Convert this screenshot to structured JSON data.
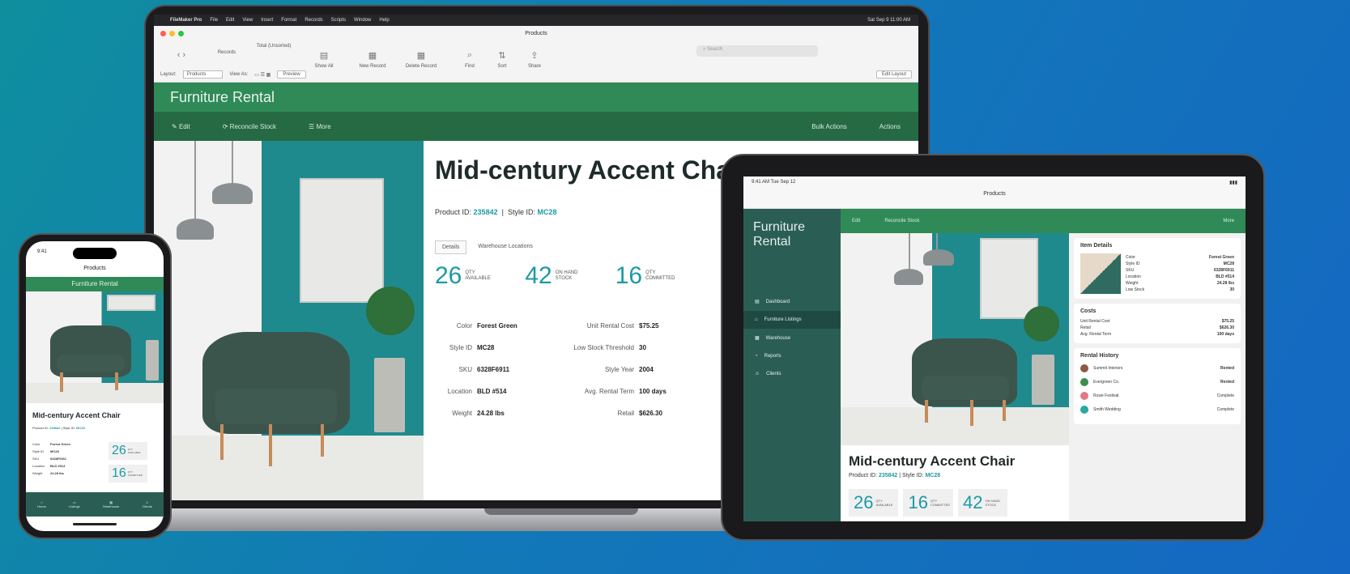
{
  "laptop": {
    "menubar": {
      "app": "FileMaker Pro",
      "items": [
        "File",
        "Edit",
        "View",
        "Insert",
        "Format",
        "Records",
        "Scripts",
        "Window",
        "Help"
      ],
      "clock": "Sat Sep 9 11:00 AM"
    },
    "window_title": "Products",
    "toolbar": {
      "records": "Records",
      "total": "Total (Unsorted)",
      "show_all": "Show All",
      "new_record": "New Record",
      "delete_record": "Delete Record",
      "find": "Find",
      "sort": "Sort",
      "share": "Share",
      "search_placeholder": "Search"
    },
    "layoutbar": {
      "layout_label": "Layout:",
      "layout_value": "Products",
      "view_as": "View As:",
      "preview": "Preview",
      "edit_layout": "Edit Layout"
    },
    "app_title": "Furniture Rental",
    "actions": {
      "edit": "Edit",
      "reconcile": "Reconcile Stock",
      "more": "More",
      "bulk_actions": "Bulk Actions",
      "actions": "Actions"
    },
    "product": {
      "title": "Mid-century Accent Chair",
      "product_id_label": "Product ID:",
      "product_id": "235842",
      "style_id_label": "Style ID:",
      "style_id": "MC28",
      "tabs": [
        "Details",
        "Warehouse Locations"
      ],
      "stats": [
        {
          "value": "26",
          "label": "QTY AVAILABLE"
        },
        {
          "value": "42",
          "label": "ON HAND STOCK"
        },
        {
          "value": "16",
          "label": "QTY COMMITTED"
        }
      ],
      "details": [
        {
          "k": "Color",
          "v": "Forest Green",
          "k2": "Unit Rental Cost",
          "v2": "$75.25"
        },
        {
          "k": "Style ID",
          "v": "MC28",
          "k2": "Low Stock Threshold",
          "v2": "30"
        },
        {
          "k": "SKU",
          "v": "6328F6911",
          "k2": "Style Year",
          "v2": "2004"
        },
        {
          "k": "Location",
          "v": "BLD #514",
          "k2": "Avg. Rental Term",
          "v2": "100 days"
        },
        {
          "k": "Weight",
          "v": "24.28 lbs",
          "k2": "Retail",
          "v2": "$626.30"
        }
      ]
    }
  },
  "ipad": {
    "status_time": "9:41 AM  Tue Sep 12",
    "nav_title": "Products",
    "brand": "Furniture Rental",
    "nav": [
      "Dashboard",
      "Furniture Listings",
      "Warehouse",
      "Reports",
      "Clients"
    ],
    "actions": {
      "edit": "Edit",
      "reconcile": "Reconcile Stock",
      "more": "More"
    },
    "title": "Mid-century Accent Chair",
    "product_id_label": "Product ID:",
    "product_id": "235842",
    "style_id_label": "Style ID:",
    "style_id": "MC28",
    "stats": [
      {
        "value": "26",
        "label": "QTY AVAILABLE"
      },
      {
        "value": "16",
        "label": "QTY COMMITTED"
      },
      {
        "value": "42",
        "label": "ON HAND STOCK"
      }
    ],
    "item_details": {
      "title": "Item Details",
      "rows": [
        {
          "k": "Color",
          "v": "Forest Green"
        },
        {
          "k": "Style ID",
          "v": "MC28"
        },
        {
          "k": "SKU",
          "v": "6328F6911"
        },
        {
          "k": "Location",
          "v": "BLD #514"
        },
        {
          "k": "Weight",
          "v": "24.28 lbs"
        },
        {
          "k": "Low Stock",
          "v": "30"
        }
      ]
    },
    "costs": {
      "title": "Costs",
      "rows": [
        {
          "k": "Unit Rental Cost",
          "v": "$75.25"
        },
        {
          "k": "Retail",
          "v": "$626.30"
        },
        {
          "k": "Avg. Rental Term",
          "v": "100 days"
        }
      ]
    },
    "history": {
      "title": "Rental History",
      "rows": [
        {
          "name": "Summit Interiors",
          "status": "Rented",
          "color": "#8a5a44"
        },
        {
          "name": "Evergreen Co.",
          "status": "Rented",
          "color": "#3e8d4f"
        },
        {
          "name": "Rosie Festival",
          "status": "Complete",
          "color": "#e07a86"
        },
        {
          "name": "Smith Wedding",
          "status": "Complete",
          "color": "#2ca7a1"
        }
      ]
    }
  },
  "iphone": {
    "time": "9:41",
    "nav_title": "Products",
    "brand": "Furniture Rental",
    "title": "Mid-century Accent Chair",
    "product_id_label": "Product ID:",
    "product_id": "235842",
    "style_id_label": "Style ID:",
    "style_id": "MC28",
    "rows": [
      {
        "k": "Color",
        "v": "Forest Green"
      },
      {
        "k": "Style ID",
        "v": "MC28"
      },
      {
        "k": "SKU",
        "v": "6328F6911"
      },
      {
        "k": "Location",
        "v": "BLD #514"
      },
      {
        "k": "Weight",
        "v": "24.28 lbs"
      }
    ],
    "stats": [
      {
        "value": "26",
        "label": "QTY AVAILABLE"
      },
      {
        "value": "16",
        "label": "QTY COMMITTED"
      }
    ],
    "tabs": [
      "Home",
      "Listings",
      "Warehouse",
      "Clients"
    ]
  }
}
